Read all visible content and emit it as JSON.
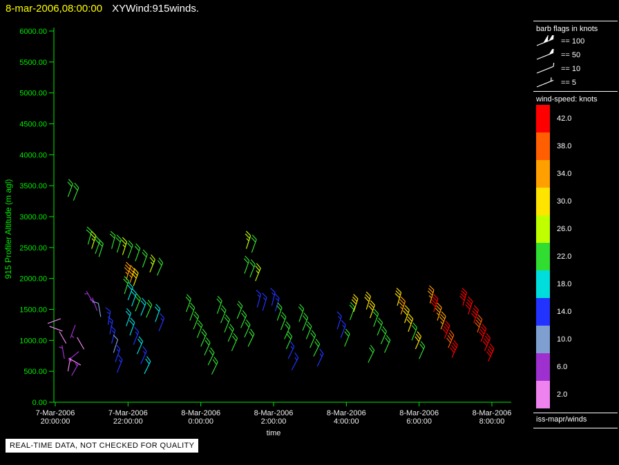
{
  "header": {
    "timestamp": "8-mar-2006,08:00:00",
    "title": "XYWind:915winds."
  },
  "axes": {
    "y_label": "915 Profiler Altitude (m agl)",
    "x_label": "time",
    "y_ticks": [
      "6000.00",
      "5500.00",
      "5000.00",
      "4500.00",
      "4000.00",
      "3500.00",
      "3000.00",
      "2500.00",
      "2000.00",
      "1500.00",
      "1000.00",
      "500.00",
      "0.00"
    ],
    "x_ticks": [
      {
        "date": "7-Mar-2006",
        "time": "20:00:00"
      },
      {
        "date": "7-Mar-2006",
        "time": "22:00:00"
      },
      {
        "date": "8-Mar-2006",
        "time": "0:00:00"
      },
      {
        "date": "8-Mar-2006",
        "time": "2:00:00"
      },
      {
        "date": "8-Mar-2006",
        "time": "4:00:00"
      },
      {
        "date": "8-Mar-2006",
        "time": "6:00:00"
      },
      {
        "date": "8-Mar-2006",
        "time": "8:00:00"
      }
    ]
  },
  "legend": {
    "barb_title": "barb flags in knots",
    "barb_items": [
      {
        "label": "== 100",
        "knots": 100
      },
      {
        "label": "== 50",
        "knots": 50
      },
      {
        "label": "== 10",
        "knots": 10
      },
      {
        "label": "== 5",
        "knots": 5
      }
    ],
    "speed_title": "wind-speed: knots",
    "speed_scale": [
      {
        "value": "42.0",
        "color": "#ff0000"
      },
      {
        "value": "38.0",
        "color": "#ff5f00"
      },
      {
        "value": "34.0",
        "color": "#ff9f00"
      },
      {
        "value": "30.0",
        "color": "#ffe400"
      },
      {
        "value": "26.0",
        "color": "#bfff00"
      },
      {
        "value": "22.0",
        "color": "#30dd30"
      },
      {
        "value": "18.0",
        "color": "#00dddd"
      },
      {
        "value": "14.0",
        "color": "#2233ff"
      },
      {
        "value": "10.0",
        "color": "#7f9fd0"
      },
      {
        "value": "6.0",
        "color": "#9f30d0"
      },
      {
        "value": "2.0",
        "color": "#ee82ee"
      }
    ],
    "footer": "iss-mapr/winds"
  },
  "banner": "REAL-TIME DATA, NOT CHECKED FOR QUALITY",
  "colors": {
    "axis": "#00ee00",
    "title_time": "#ffff00",
    "text": "#f0f0f0"
  },
  "chart_data": {
    "type": "scatter",
    "subtype": "wind-barbs",
    "title": "XYWind:915winds.",
    "xlabel": "time",
    "ylabel": "915 Profiler Altitude (m agl)",
    "x_start": "7-Mar-2006 20:00:00",
    "x_end": "8-Mar-2006 8:00:00",
    "x_ticks_hours": [
      0,
      2,
      4,
      6,
      8,
      10,
      12
    ],
    "ylim": [
      0,
      6000
    ],
    "grid": false,
    "legend_position": "right",
    "point_format": [
      "hours_after_20:00",
      "altitude_m",
      "speed_knots",
      "shaft_angle_deg"
    ],
    "points": [
      [
        0.35,
        3320,
        22,
        70
      ],
      [
        0.5,
        3260,
        22,
        68
      ],
      [
        0.15,
        1350,
        2,
        200
      ],
      [
        0.2,
        1150,
        2,
        160
      ],
      [
        0.3,
        950,
        2,
        120
      ],
      [
        0.25,
        700,
        6,
        100
      ],
      [
        0.35,
        500,
        2,
        80
      ],
      [
        0.55,
        1250,
        6,
        250
      ],
      [
        0.6,
        1050,
        2,
        300
      ],
      [
        0.65,
        820,
        6,
        220
      ],
      [
        0.7,
        600,
        2,
        150
      ],
      [
        0.45,
        430,
        6,
        60
      ],
      [
        0.9,
        2550,
        22,
        75
      ],
      [
        1.0,
        2480,
        26,
        72
      ],
      [
        1.1,
        2400,
        22,
        70
      ],
      [
        1.2,
        2350,
        22,
        72
      ],
      [
        1.05,
        1600,
        6,
        120
      ],
      [
        1.15,
        1480,
        6,
        110
      ],
      [
        1.25,
        1380,
        10,
        100
      ],
      [
        1.45,
        1250,
        14,
        80
      ],
      [
        1.5,
        1100,
        14,
        78
      ],
      [
        1.55,
        950,
        14,
        75
      ],
      [
        1.6,
        800,
        10,
        72
      ],
      [
        1.65,
        650,
        14,
        70
      ],
      [
        1.7,
        480,
        14,
        68
      ],
      [
        1.55,
        2480,
        22,
        75
      ],
      [
        1.7,
        2420,
        22,
        73
      ],
      [
        1.85,
        2380,
        26,
        72
      ],
      [
        2.0,
        2330,
        22,
        70
      ],
      [
        2.2,
        2280,
        22,
        70
      ],
      [
        2.4,
        2180,
        22,
        70
      ],
      [
        2.6,
        2100,
        26,
        68
      ],
      [
        2.8,
        2050,
        22,
        66
      ],
      [
        1.95,
        1980,
        34,
        72
      ],
      [
        2.05,
        1930,
        34,
        70
      ],
      [
        2.15,
        1880,
        30,
        70
      ],
      [
        1.9,
        1750,
        22,
        72
      ],
      [
        2.0,
        1650,
        18,
        70
      ],
      [
        2.1,
        1550,
        18,
        70
      ],
      [
        2.2,
        1470,
        22,
        68
      ],
      [
        2.35,
        1400,
        18,
        68
      ],
      [
        2.5,
        1370,
        22,
        66
      ],
      [
        1.95,
        1230,
        18,
        70
      ],
      [
        2.05,
        1080,
        18,
        70
      ],
      [
        2.15,
        930,
        14,
        68
      ],
      [
        2.25,
        780,
        18,
        66
      ],
      [
        2.35,
        620,
        14,
        65
      ],
      [
        2.45,
        460,
        18,
        64
      ],
      [
        2.75,
        1300,
        18,
        70
      ],
      [
        2.85,
        1150,
        14,
        68
      ],
      [
        3.6,
        1460,
        22,
        70
      ],
      [
        3.7,
        1320,
        22,
        70
      ],
      [
        3.8,
        1180,
        22,
        68
      ],
      [
        3.9,
        1040,
        22,
        68
      ],
      [
        4.0,
        900,
        22,
        66
      ],
      [
        4.1,
        760,
        22,
        66
      ],
      [
        4.2,
        600,
        22,
        64
      ],
      [
        4.3,
        450,
        22,
        64
      ],
      [
        4.45,
        1430,
        22,
        70
      ],
      [
        4.55,
        1280,
        22,
        68
      ],
      [
        4.65,
        1130,
        22,
        68
      ],
      [
        4.75,
        980,
        22,
        66
      ],
      [
        4.85,
        830,
        22,
        66
      ],
      [
        5.25,
        2480,
        26,
        72
      ],
      [
        5.4,
        2420,
        22,
        70
      ],
      [
        5.2,
        2080,
        22,
        70
      ],
      [
        5.35,
        2020,
        22,
        68
      ],
      [
        5.5,
        1960,
        26,
        68
      ],
      [
        5.0,
        1350,
        22,
        68
      ],
      [
        5.1,
        1200,
        22,
        66
      ],
      [
        5.2,
        1050,
        22,
        66
      ],
      [
        5.3,
        900,
        22,
        64
      ],
      [
        5.55,
        1530,
        14,
        75
      ],
      [
        5.7,
        1480,
        14,
        73
      ],
      [
        5.95,
        1560,
        14,
        76
      ],
      [
        6.05,
        1470,
        14,
        74
      ],
      [
        6.1,
        1320,
        22,
        70
      ],
      [
        6.2,
        1170,
        22,
        68
      ],
      [
        6.3,
        1020,
        22,
        66
      ],
      [
        6.35,
        860,
        22,
        66
      ],
      [
        6.4,
        700,
        14,
        64
      ],
      [
        6.5,
        520,
        14,
        62
      ],
      [
        6.7,
        1300,
        22,
        70
      ],
      [
        6.8,
        1160,
        22,
        68
      ],
      [
        6.9,
        1020,
        22,
        68
      ],
      [
        7.0,
        880,
        22,
        66
      ],
      [
        7.1,
        740,
        22,
        64
      ],
      [
        7.2,
        580,
        14,
        64
      ],
      [
        7.75,
        1180,
        14,
        72
      ],
      [
        7.85,
        1040,
        14,
        70
      ],
      [
        7.95,
        900,
        22,
        68
      ],
      [
        8.1,
        1330,
        22,
        70
      ],
      [
        8.2,
        1460,
        30,
        72
      ],
      [
        8.55,
        1500,
        30,
        72
      ],
      [
        8.65,
        1360,
        30,
        70
      ],
      [
        8.75,
        1220,
        22,
        70
      ],
      [
        8.85,
        1080,
        22,
        68
      ],
      [
        8.95,
        940,
        22,
        66
      ],
      [
        9.05,
        800,
        22,
        66
      ],
      [
        8.6,
        640,
        22,
        64
      ],
      [
        9.4,
        1560,
        30,
        74
      ],
      [
        9.5,
        1420,
        34,
        72
      ],
      [
        9.6,
        1280,
        30,
        70
      ],
      [
        9.7,
        1140,
        30,
        70
      ],
      [
        9.8,
        1000,
        22,
        68
      ],
      [
        9.9,
        860,
        30,
        66
      ],
      [
        10.0,
        700,
        22,
        66
      ],
      [
        10.3,
        1600,
        34,
        74
      ],
      [
        10.4,
        1460,
        42,
        72
      ],
      [
        10.5,
        1320,
        34,
        72
      ],
      [
        10.6,
        1180,
        34,
        70
      ],
      [
        10.7,
        1030,
        42,
        68
      ],
      [
        10.8,
        880,
        38,
        66
      ],
      [
        10.9,
        720,
        42,
        66
      ],
      [
        11.2,
        1560,
        42,
        74
      ],
      [
        11.35,
        1420,
        42,
        72
      ],
      [
        11.5,
        1280,
        42,
        70
      ],
      [
        11.6,
        1130,
        38,
        70
      ],
      [
        11.7,
        980,
        42,
        68
      ],
      [
        11.8,
        830,
        42,
        66
      ],
      [
        11.9,
        660,
        42,
        66
      ]
    ]
  }
}
